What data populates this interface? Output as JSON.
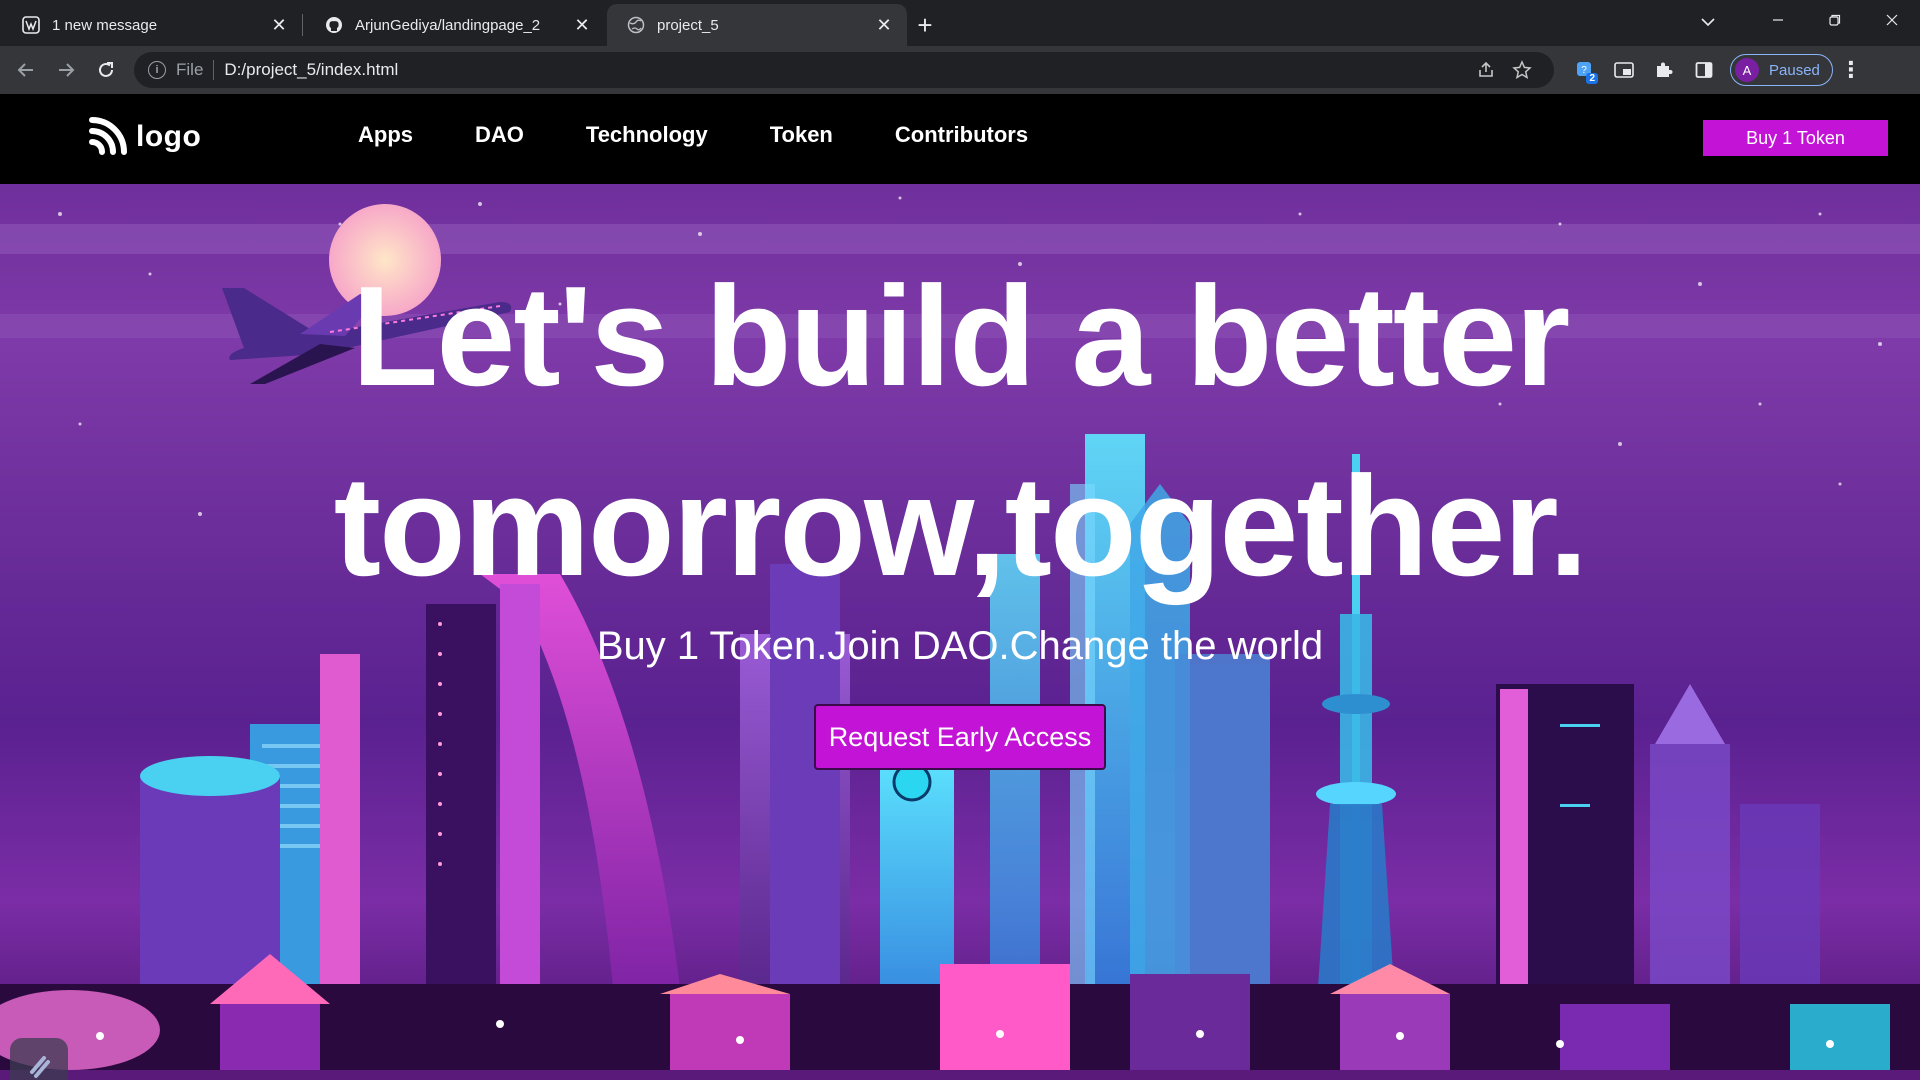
{
  "browser": {
    "tabs": [
      {
        "title": "1 new message",
        "icon": "wordpress-icon"
      },
      {
        "title": "ArjunGediya/landingpage_2",
        "icon": "github-icon"
      },
      {
        "title": "project_5",
        "icon": "globe-icon"
      }
    ],
    "address": {
      "scheme": "File",
      "path": "D:/project_5/index.html"
    },
    "profile": {
      "initial": "A",
      "status": "Paused"
    },
    "extension_badge": "2"
  },
  "site": {
    "logo_text": "logo",
    "nav": [
      "Apps",
      "DAO",
      "Technology",
      "Token",
      "Contributors"
    ],
    "buy_button": "Buy 1 Token",
    "hero": {
      "title_line1": "Let's build a better",
      "title_line2": "tomorrow,together.",
      "subtitle": "Buy 1 Token.Join DAO.Change the world",
      "cta": "Request Early Access"
    }
  },
  "colors": {
    "accent": "#c313d6",
    "nav_bg": "#000000"
  }
}
